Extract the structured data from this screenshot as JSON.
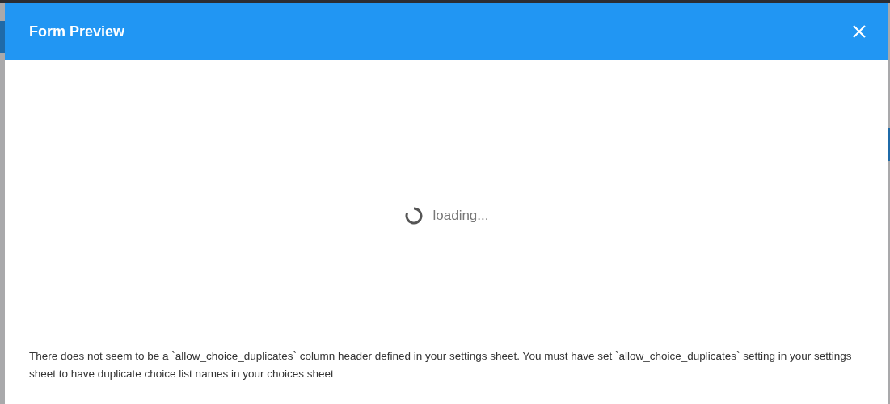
{
  "dialog": {
    "title": "Form Preview",
    "loading_text": "loading...",
    "message": "There does not seem to be a `allow_choice_duplicates` column header defined in your settings sheet. You must have set `allow_choice_duplicates` setting in your settings sheet to have duplicate choice list names in your choices sheet"
  }
}
